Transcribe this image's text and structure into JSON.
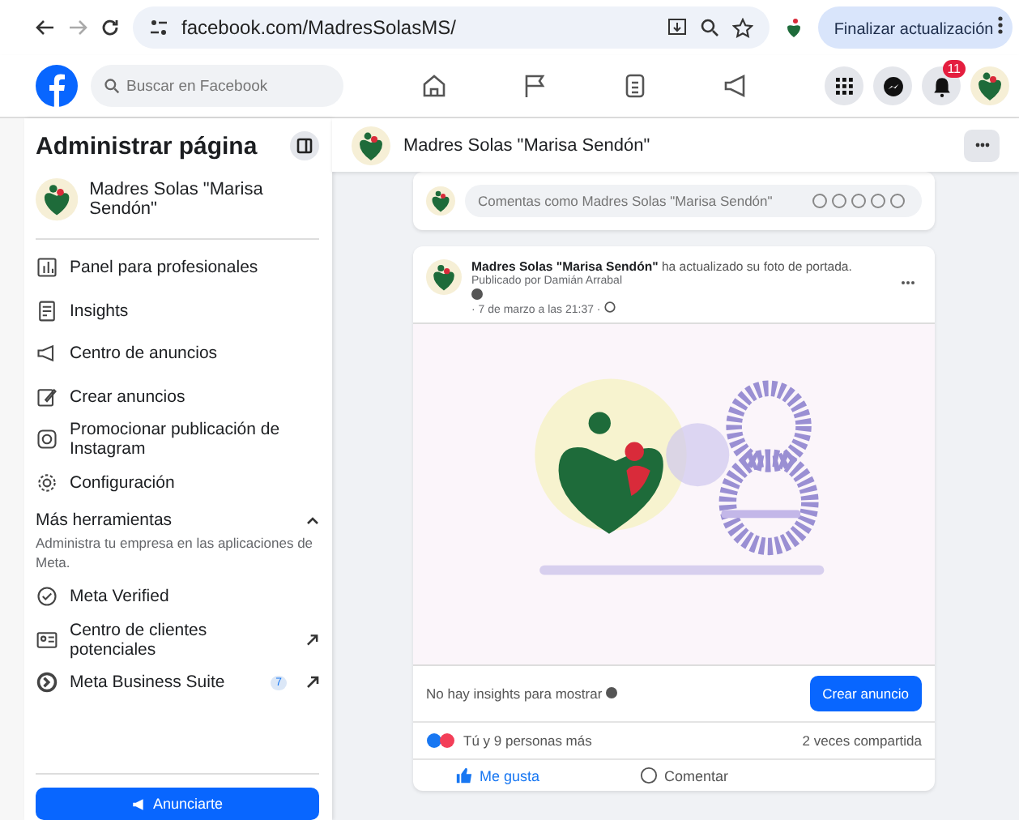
{
  "browser": {
    "url": "facebook.com/MadresSolasMS/",
    "update_button": "Finalizar actualización"
  },
  "topbar": {
    "search": {
      "placeholder": "Buscar en Facebook"
    },
    "notification_count": "11"
  },
  "sidebar": {
    "title": "Administrar página",
    "page_name": "Madres Solas \"Marisa Sendón\"",
    "items": [
      {
        "kind": "chart",
        "label": "Panel para profesionales"
      },
      {
        "kind": "insights",
        "label": "Insights"
      },
      {
        "kind": "megaphone",
        "label": "Centro de anuncios"
      },
      {
        "kind": "pencil",
        "label": "Crear anuncios"
      },
      {
        "kind": "instagram",
        "label": "Promocionar publicación de Instagram"
      },
      {
        "kind": "gear",
        "label": "Configuración"
      }
    ],
    "more_tools": {
      "title": "Más herramientas",
      "expanded": true,
      "description": "Administra tu empresa en las aplicaciones de Meta."
    },
    "tools": [
      {
        "kind": "verified",
        "label": "Meta Verified",
        "external": false
      },
      {
        "kind": "contacts",
        "label": "Centro de clientes potenciales",
        "external": true
      },
      {
        "kind": "suite",
        "label": "Meta Business Suite",
        "badge": "7",
        "external": true
      }
    ],
    "advertise_button": "Anunciarte"
  },
  "page_header": {
    "name": "Madres Solas \"Marisa Sendón\""
  },
  "comment_box": {
    "placeholder": "Comentas como Madres Solas \"Marisa Sendón\""
  },
  "post": {
    "author": "Madres Solas \"Marisa Sendón\"",
    "action": "ha actualizado su foto de portada.",
    "published_by": "Publicado por Damián Arrabal",
    "date": "· 7 de marzo a las 21:37 ·",
    "image": {
      "kind": "picture"
    },
    "insights_text": "No hay insights para mostrar",
    "create_ad_button": "Crear anuncio",
    "reactions": "Tú y 9 personas más",
    "shares": "2 veces compartida",
    "actions": [
      "Me gusta",
      "Comentar"
    ]
  }
}
